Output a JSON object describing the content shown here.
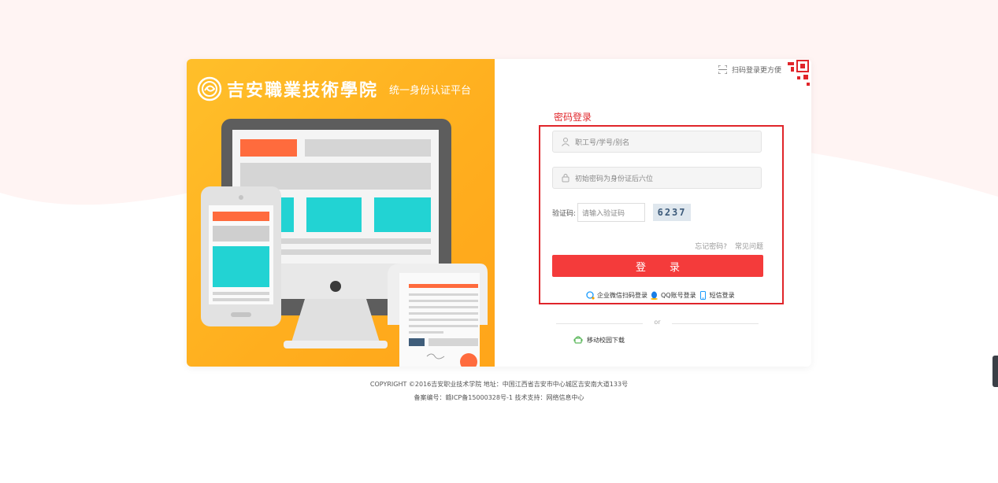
{
  "header": {
    "school_name": "吉安職業技術學院",
    "platform_name": "统一身份认证平台"
  },
  "qr": {
    "tip": "扫码登录更方便",
    "icon": "qr-code-icon"
  },
  "login": {
    "title": "密码登录",
    "username_placeholder": "职工号/学号/别名",
    "password_placeholder": "初始密码为身份证后六位",
    "captcha_label": "验证码:",
    "captcha_placeholder": "请输入验证码",
    "captcha_code": "6237",
    "forgot": "忘记密码?",
    "faq": "常见问题",
    "submit": "登录",
    "alt": {
      "wechat": "企业微信扫码登录",
      "qq": "QQ账号登录",
      "sms": "短信登录"
    }
  },
  "divider": "or",
  "app_download": "移动校园下载",
  "footer": {
    "line1": "COPYRIGHT ©2016吉安职业技术学院 地址：中国江西省吉安市中心城区吉安南大道133号",
    "line2": "备案编号：赣ICP备15000328号-1 技术支持：网络信息中心"
  },
  "colors": {
    "accent": "#e0252a",
    "button": "#f43b3b",
    "left_panel": "#ffb321",
    "background_wave": "#fff4f3"
  }
}
